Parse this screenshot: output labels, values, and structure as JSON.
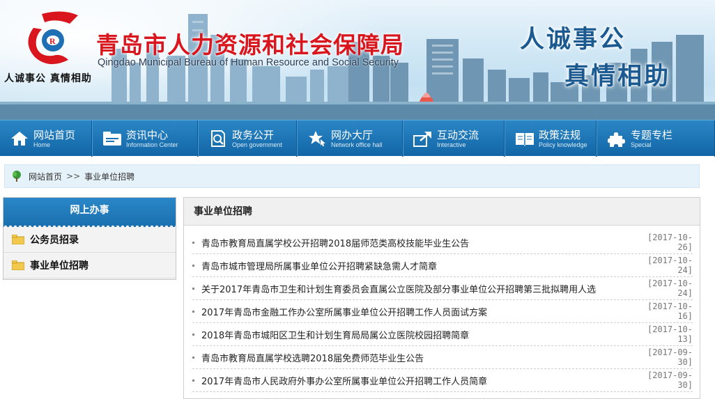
{
  "header": {
    "logo_slogan": "人诚事公  真情相助",
    "bureau_name_cn": "青岛市人力资源和社会保障局",
    "bureau_name_en": "Qingdao Municipal Bureau of Human Resource and Social Security",
    "slogan_line1": "人诚事公",
    "slogan_line2": "真情相助"
  },
  "nav": {
    "items": [
      {
        "cn": "网站首页",
        "en": "Home",
        "icon": "home-icon"
      },
      {
        "cn": "资讯中心",
        "en": "Information Center",
        "icon": "folder-icon"
      },
      {
        "cn": "政务公开",
        "en": "Open government",
        "icon": "search-icon"
      },
      {
        "cn": "网办大厅",
        "en": "Network office hall",
        "icon": "star-icon"
      },
      {
        "cn": "互动交流",
        "en": "Interactive",
        "icon": "share-icon"
      },
      {
        "cn": "政策法规",
        "en": "Policy knowledge",
        "icon": "book-icon"
      },
      {
        "cn": "专题专栏",
        "en": "Special",
        "icon": "puzzle-icon"
      }
    ]
  },
  "breadcrumb": {
    "home": "网站首页",
    "separator": ">>",
    "current": "事业单位招聘"
  },
  "sidebar": {
    "title": "网上办事",
    "items": [
      {
        "label": "公务员招录"
      },
      {
        "label": "事业单位招聘"
      }
    ]
  },
  "main": {
    "title": "事业单位招聘",
    "rows": [
      {
        "title": "青岛市教育局直属学校公开招聘2018届师范类高校技能毕业生公告",
        "date": "[2017-10-26]"
      },
      {
        "title": "青岛市城市管理局所属事业单位公开招聘紧缺急需人才简章",
        "date": "[2017-10-24]"
      },
      {
        "title": "关于2017年青岛市卫生和计划生育委员会直属公立医院及部分事业单位公开招聘第三批拟聘用人选",
        "date": "[2017-10-24]"
      },
      {
        "title": "2017年青岛市金融工作办公室所属事业单位公开招聘工作人员面试方案",
        "date": "[2017-10-16]"
      },
      {
        "title": "2018年青岛市城阳区卫生和计划生育局局属公立医院校园招聘简章",
        "date": "[2017-10-13]"
      },
      {
        "title": "青岛市教育局直属学校选聘2018届免费师范毕业生公告",
        "date": "[2017-09-30]"
      },
      {
        "title": "2017年青岛市人民政府外事办公室所属事业单位公开招聘工作人员简章",
        "date": "[2017-09-30]"
      }
    ]
  },
  "colors": {
    "nav_blue": "#1a73b3",
    "title_red": "#d9161e",
    "slogan_blue": "#1a5a91"
  }
}
